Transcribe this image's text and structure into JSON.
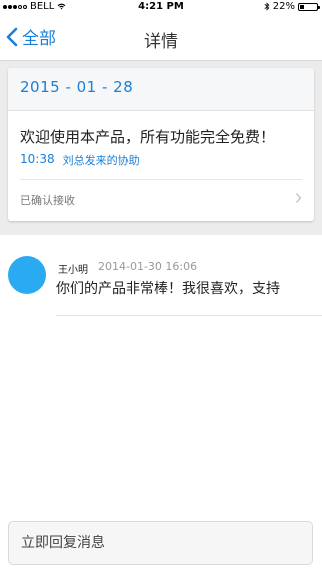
{
  "status_bar": {
    "carrier": "BELL",
    "time": "4:21 PM",
    "battery": "22%",
    "battery_level": 0.22
  },
  "nav": {
    "back_label": "全部",
    "title": "详情"
  },
  "card": {
    "date": "2015 - 01 - 28",
    "message": "欢迎使用本产品，所有功能完全免费！",
    "time": "10:38",
    "assist": "刘总发来的协助",
    "status": "已确认接收"
  },
  "reply": {
    "name": "王小明",
    "date": "2014-01-30  16:06",
    "text": "你们的产品非常棒！我很喜欢，支持"
  },
  "reply_bar": {
    "placeholder": "立即回复消息"
  },
  "colors": {
    "accent": "#1a7fd8",
    "avatar": "#2aaaf0",
    "background_gray": "#ececec"
  },
  "icons": [
    "signal-icon",
    "wifi-icon",
    "bluetooth-icon",
    "battery-icon",
    "back-chevron-icon",
    "chevron-right-icon"
  ]
}
